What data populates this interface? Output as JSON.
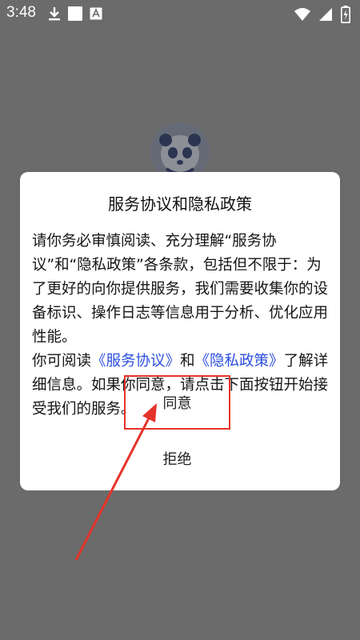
{
  "status_bar": {
    "time": "3:48",
    "left_icons": [
      "download-icon",
      "white-square-icon",
      "text-a-icon"
    ],
    "right_icons": [
      "wifi-icon",
      "signal-icon",
      "battery-charging-icon"
    ]
  },
  "background": {
    "logo_icon": "panda-logo-icon"
  },
  "dialog": {
    "title": "服务协议和隐私政策",
    "para1": "请你务必审慎阅读、充分理解“服务协议”和“隐私政策”各条款，包括但不限于：为了更好的向你提供服务，我们需要收集你的设备标识、操作日志等信息用于分析、优化应用性能。",
    "para2_pre": "你可阅读",
    "link_service": "《服务协议》",
    "para2_and": "和",
    "link_privacy": "《隐私政策》",
    "para2_post": "了解详细信息。如果你同意，请点击下面按钮开始接受我们的服务。",
    "agree_label": "同意",
    "reject_label": "拒绝"
  },
  "colors": {
    "overlay": "#6b6b6b",
    "link": "#2c4fe0",
    "annotation": "#e6332a"
  }
}
